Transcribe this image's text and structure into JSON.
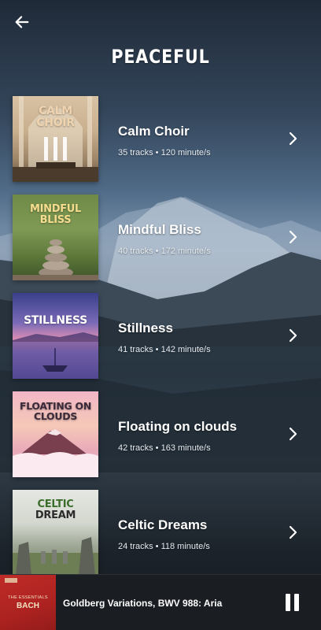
{
  "header": {
    "title": "PEACEFUL",
    "back_icon": "arrow-left-icon"
  },
  "playlists": [
    {
      "title": "Calm Choir",
      "meta": "35 tracks • 120 minute/s",
      "cover_text": "CALM\nCHOIR",
      "cover_line1": "CALM",
      "cover_line2": "CHOIR",
      "cover_color": "#e9c9a4"
    },
    {
      "title": "Mindful Bliss",
      "meta": "40 tracks • 172 minute/s",
      "cover_line1": "MINDFUL",
      "cover_line2": "BLISS",
      "cover_color": "#f2d58a"
    },
    {
      "title": "Stillness",
      "meta": "41 tracks • 142 minute/s",
      "cover_line1": "STILLNESS",
      "cover_line2": "",
      "cover_color": "#ffffff"
    },
    {
      "title": "Floating on clouds",
      "meta": "42 tracks • 163 minute/s",
      "cover_line1": "FLOATING ON",
      "cover_line2": "CLOUDS",
      "cover_color": "#3a2a3a"
    },
    {
      "title": "Celtic Dreams",
      "meta": "24 tracks • 118 minute/s",
      "cover_line1": "CELTIC",
      "cover_line2": "DREAM",
      "cover_color": "#3b6d2a"
    }
  ],
  "player": {
    "track_title": "Goldberg Variations, BWV 988: Aria",
    "art_line1": "THE ESSENTIALS",
    "art_line2": "BACH",
    "pause_icon": "pause-icon"
  }
}
